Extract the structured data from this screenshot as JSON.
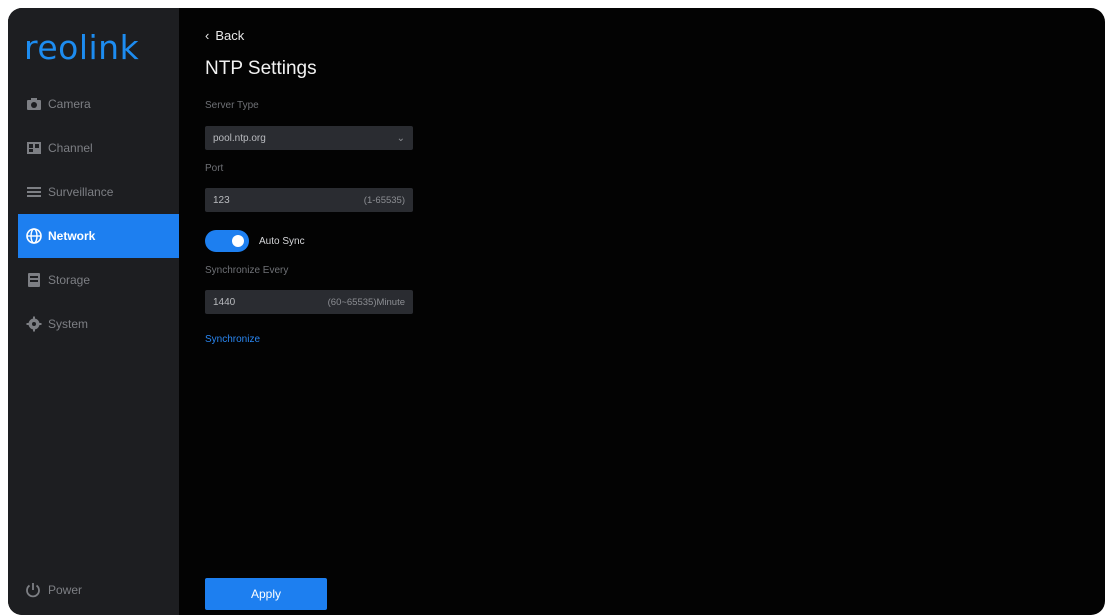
{
  "brand": {
    "logo_text": "reolink",
    "accent": "#1d7ff0"
  },
  "sidebar": {
    "items": [
      {
        "label": "Camera",
        "icon": "camera-icon",
        "active": false
      },
      {
        "label": "Channel",
        "icon": "channel-icon",
        "active": false
      },
      {
        "label": "Surveillance",
        "icon": "list-icon",
        "active": false
      },
      {
        "label": "Network",
        "icon": "globe-icon",
        "active": true
      },
      {
        "label": "Storage",
        "icon": "storage-icon",
        "active": false
      },
      {
        "label": "System",
        "icon": "gear-icon",
        "active": false
      }
    ],
    "power_label": "Power"
  },
  "header": {
    "back_label": "Back",
    "title": "NTP Settings"
  },
  "form": {
    "server_type": {
      "label": "Server Type",
      "value": "pool.ntp.org"
    },
    "port": {
      "label": "Port",
      "value": "123",
      "hint": "(1-65535)"
    },
    "auto_sync": {
      "label": "Auto Sync",
      "enabled": true
    },
    "sync_every": {
      "label": "Synchronize Every",
      "value": "1440",
      "hint": "(60~65535)Minute"
    },
    "sync_link": "Synchronize"
  },
  "footer": {
    "apply_label": "Apply"
  }
}
